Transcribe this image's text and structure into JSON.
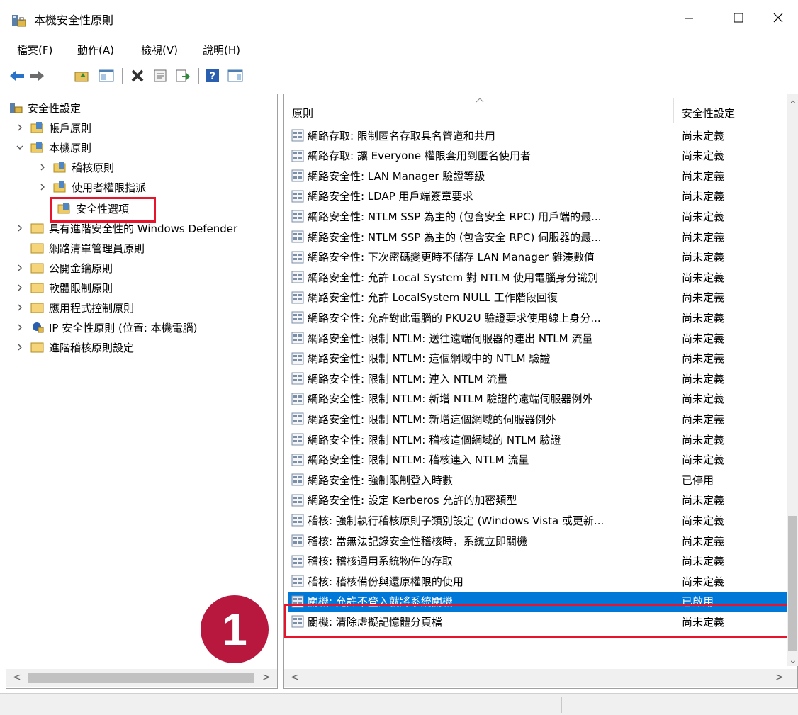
{
  "window": {
    "title": "本機安全性原則",
    "icon": "security-policy-icon"
  },
  "menu": [
    "檔案(F)",
    "動作(A)",
    "檢視(V)",
    "說明(H)"
  ],
  "toolbar": [
    "back-arrow-icon",
    "forward-arrow-icon",
    "up-folder-icon",
    "show-hide-tree-icon",
    "delete-icon",
    "properties-icon",
    "export-icon",
    "help-icon",
    "action-pane-icon"
  ],
  "tree": {
    "root": "安全性設定",
    "items": [
      {
        "label": "帳戶原則"
      },
      {
        "label": "本機原則"
      },
      {
        "label": "稽核原則"
      },
      {
        "label": "使用者權限指派"
      },
      {
        "label": "安全性選項"
      },
      {
        "label": "具有進階安全性的 Windows Defender"
      },
      {
        "label": "網路清單管理員原則"
      },
      {
        "label": "公開金鑰原則"
      },
      {
        "label": "軟體限制原則"
      },
      {
        "label": "應用程式控制原則"
      },
      {
        "label": "IP 安全性原則 (位置: 本機電腦)"
      },
      {
        "label": "進階稽核原則設定"
      }
    ]
  },
  "list": {
    "headers": {
      "policy": "原則",
      "setting": "安全性設定"
    },
    "rows": [
      {
        "name": "網路存取: 限制匿名存取具名管道和共用",
        "value": "尚未定義"
      },
      {
        "name": "網路存取: 讓 Everyone 權限套用到匿名使用者",
        "value": "尚未定義"
      },
      {
        "name": "網路安全性: LAN Manager 驗證等級",
        "value": "尚未定義"
      },
      {
        "name": "網路安全性: LDAP 用戶端簽章要求",
        "value": "尚未定義"
      },
      {
        "name": "網路安全性: NTLM SSP 為主的 (包含安全 RPC) 用戶端的最...",
        "value": "尚未定義"
      },
      {
        "name": "網路安全性: NTLM SSP 為主的 (包含安全 RPC) 伺服器的最...",
        "value": "尚未定義"
      },
      {
        "name": "網路安全性: 下次密碼變更時不儲存 LAN Manager 雜湊數值",
        "value": "尚未定義"
      },
      {
        "name": "網路安全性: 允許 Local System 對 NTLM 使用電腦身分識別",
        "value": "尚未定義"
      },
      {
        "name": "網路安全性: 允許 LocalSystem NULL 工作階段回復",
        "value": "尚未定義"
      },
      {
        "name": "網路安全性: 允許對此電腦的 PKU2U 驗證要求使用線上身分...",
        "value": "尚未定義"
      },
      {
        "name": "網路安全性: 限制 NTLM: 送往遠端伺服器的連出 NTLM 流量",
        "value": "尚未定義"
      },
      {
        "name": "網路安全性: 限制 NTLM: 這個網域中的 NTLM 驗證",
        "value": "尚未定義"
      },
      {
        "name": "網路安全性: 限制 NTLM: 連入 NTLM 流量",
        "value": "尚未定義"
      },
      {
        "name": "網路安全性: 限制 NTLM: 新增 NTLM 驗證的遠端伺服器例外",
        "value": "尚未定義"
      },
      {
        "name": "網路安全性: 限制 NTLM: 新增這個網域的伺服器例外",
        "value": "尚未定義"
      },
      {
        "name": "網路安全性: 限制 NTLM: 稽核這個網域的 NTLM 驗證",
        "value": "尚未定義"
      },
      {
        "name": "網路安全性: 限制 NTLM: 稽核連入 NTLM 流量",
        "value": "尚未定義"
      },
      {
        "name": "網路安全性: 強制限制登入時數",
        "value": "已停用"
      },
      {
        "name": "網路安全性: 設定 Kerberos 允許的加密類型",
        "value": "尚未定義"
      },
      {
        "name": "稽核: 強制執行稽核原則子類別設定 (Windows Vista 或更新...",
        "value": "尚未定義"
      },
      {
        "name": "稽核: 當無法記錄安全性稽核時，系統立即關機",
        "value": "尚未定義"
      },
      {
        "name": "稽核: 稽核通用系統物件的存取",
        "value": "尚未定義"
      },
      {
        "name": "稽核: 稽核備份與還原權限的使用",
        "value": "尚未定義"
      },
      {
        "name": "關機: 允許不登入就將系統關機",
        "value": "已啟用"
      },
      {
        "name": "關機: 清除虛擬記憶體分頁檔",
        "value": "尚未定義"
      }
    ]
  },
  "annotation": {
    "step": "1"
  },
  "colors": {
    "selection": "#0078d7",
    "highlight": "#e8142b",
    "badge": "#b8183e"
  }
}
